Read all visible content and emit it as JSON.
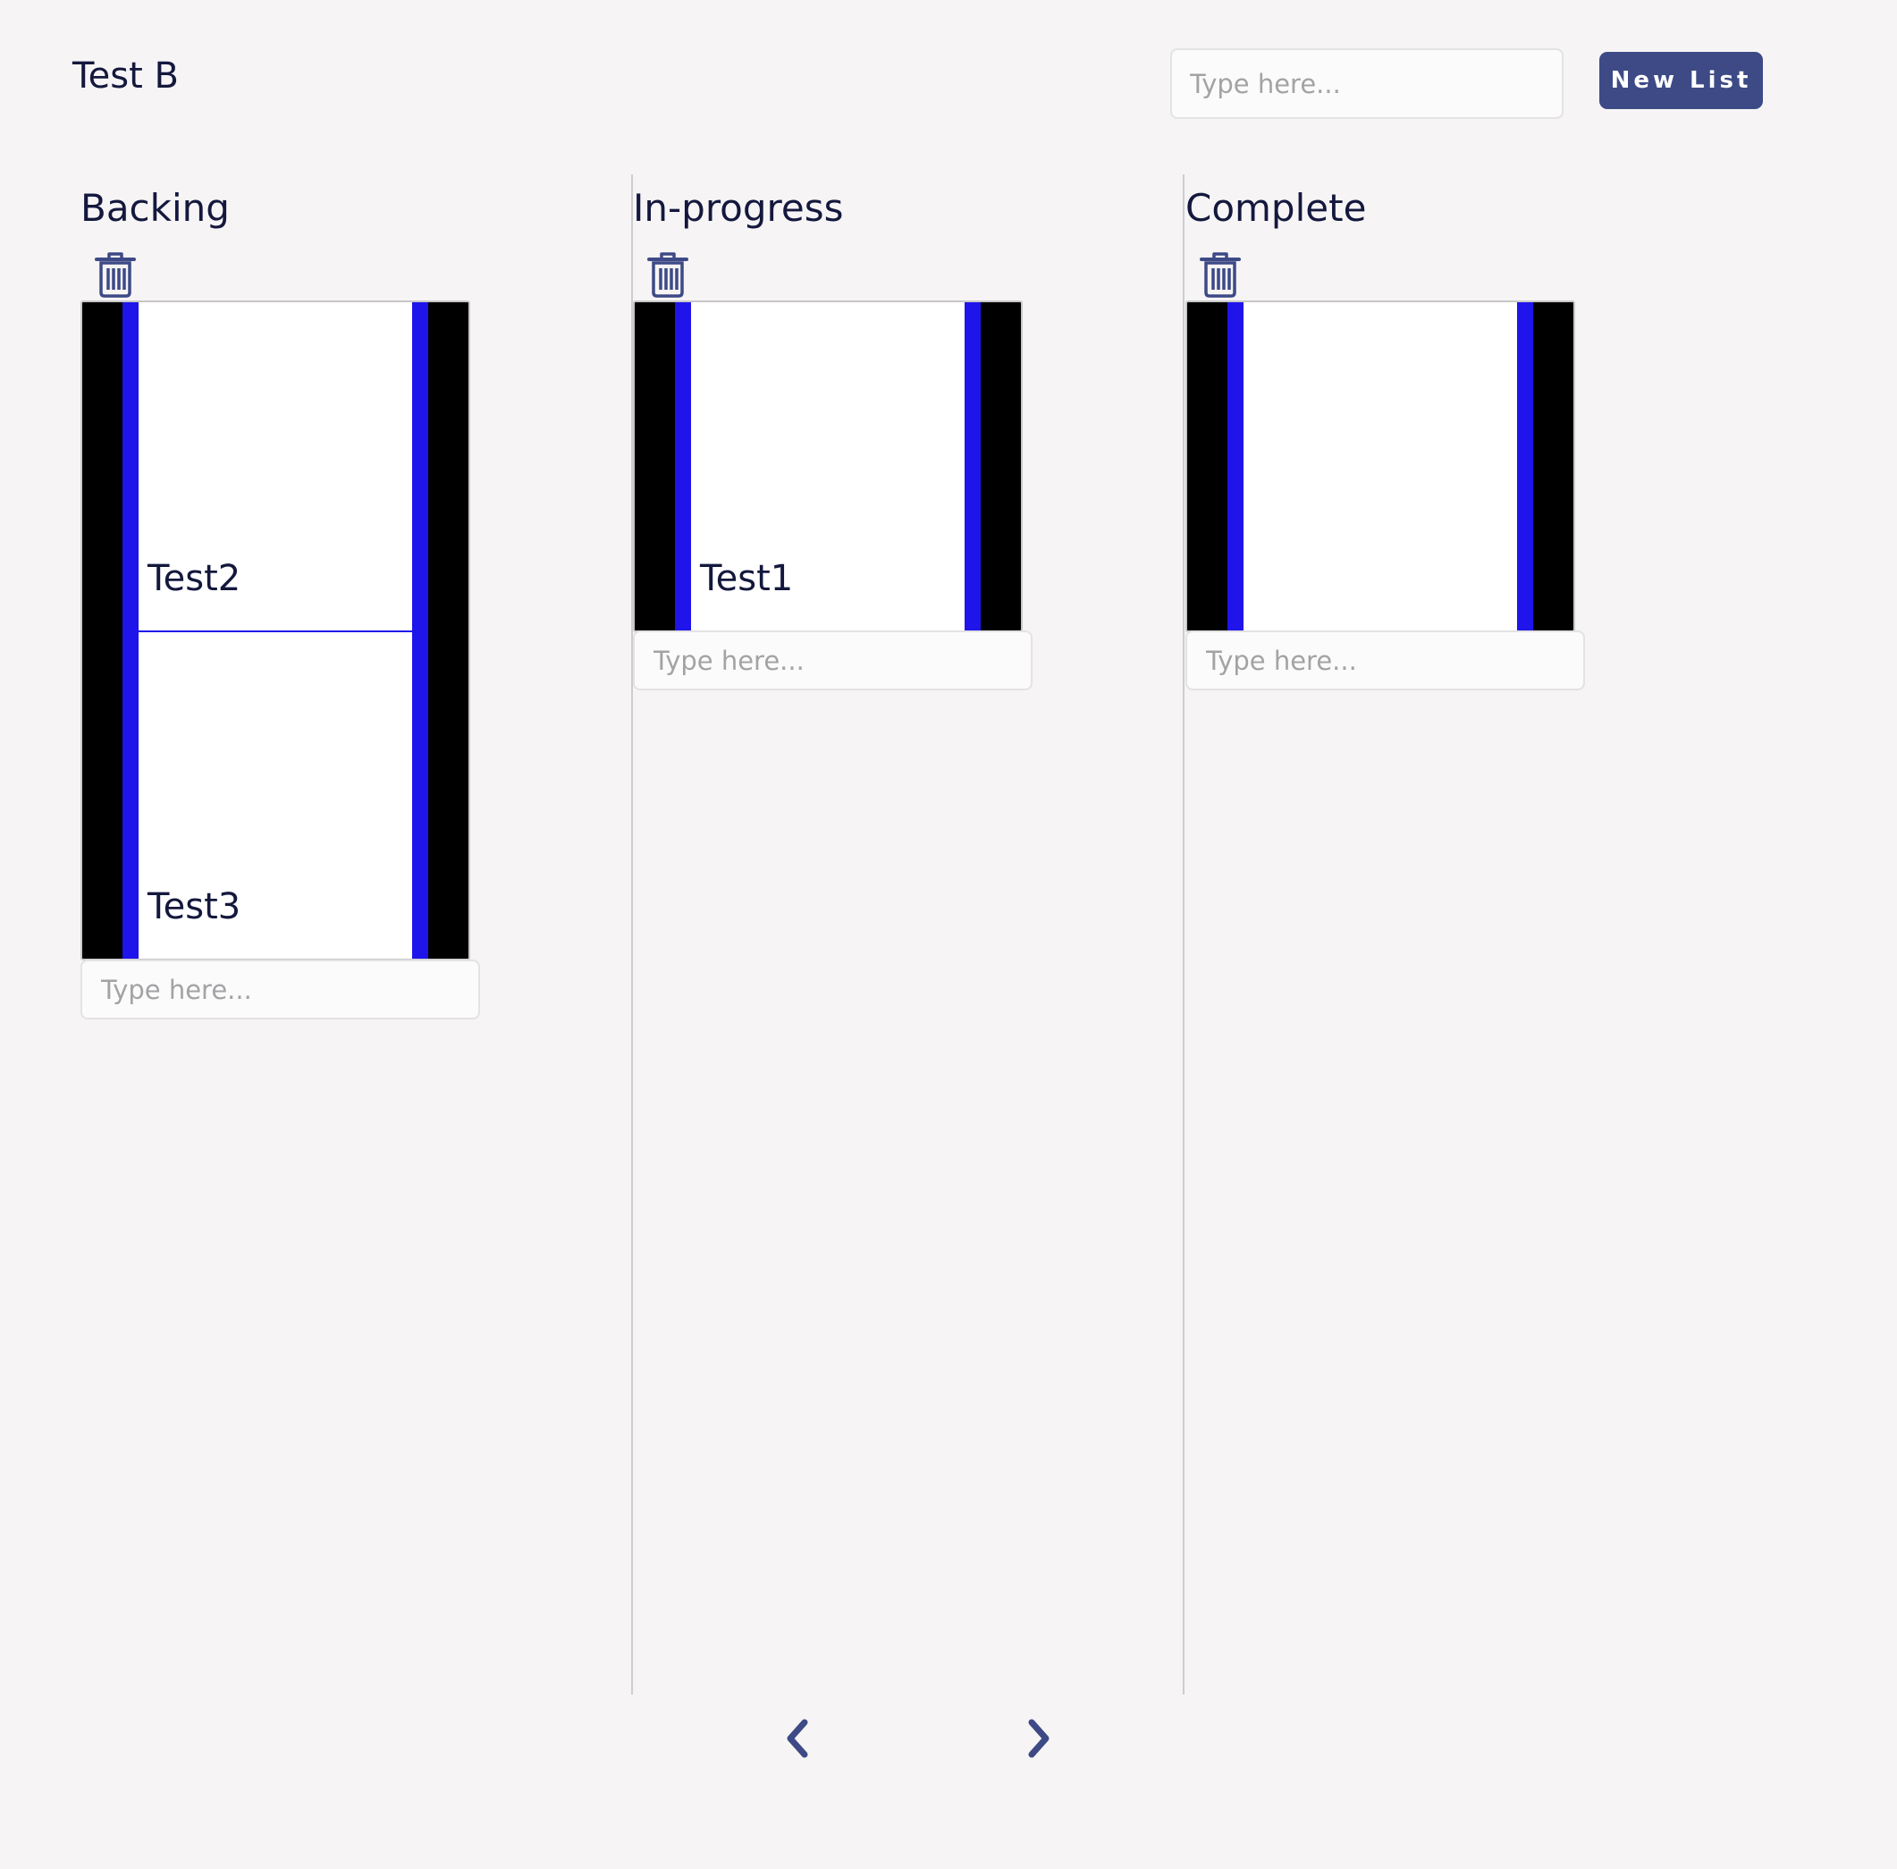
{
  "header": {
    "board_title": "Test B",
    "new_list_placeholder": "Type here...",
    "new_list_button": "New List"
  },
  "lists": [
    {
      "title": "Backing",
      "cards": [
        "Test2",
        "Test3"
      ],
      "card_input_placeholder": "Type here..."
    },
    {
      "title": "In-progress",
      "cards": [
        "Test1"
      ],
      "card_input_placeholder": "Type here..."
    },
    {
      "title": "Complete",
      "cards": [
        ""
      ],
      "card_input_placeholder": "Type here..."
    }
  ],
  "pagination": {
    "prev_icon": "chevron-left-icon",
    "next_icon": "chevron-right-icon"
  },
  "colors": {
    "accent": "#3d4a86",
    "card_border": "#1f14ea",
    "text": "#14183d",
    "background": "#f6f4f5"
  }
}
